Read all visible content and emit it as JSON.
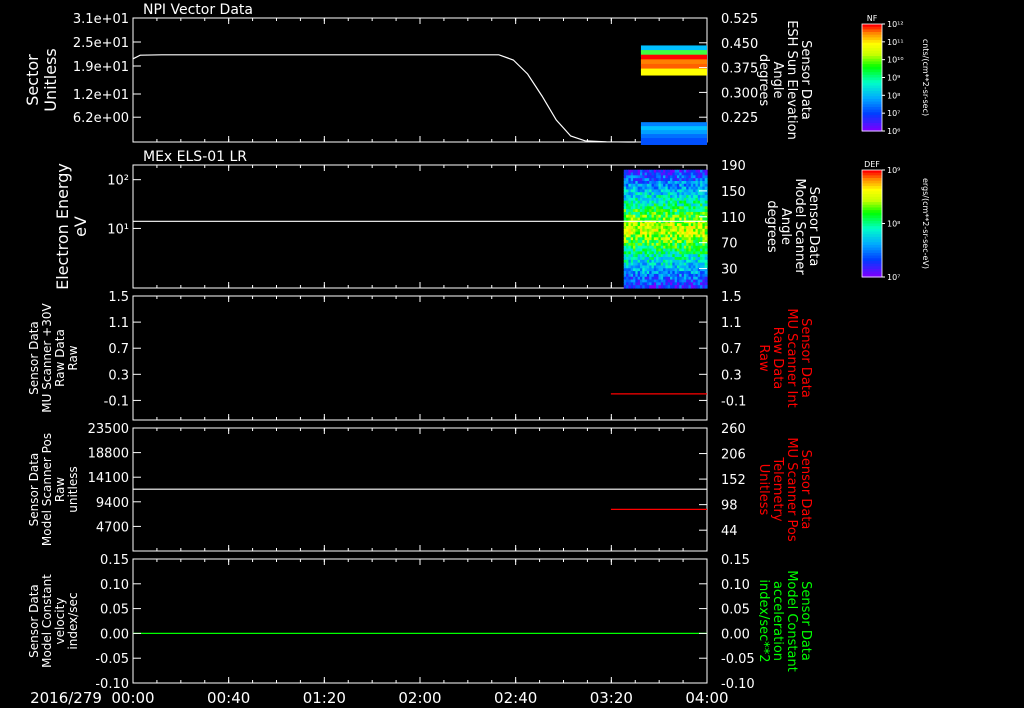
{
  "colors": {
    "background": "#000000",
    "foreground": "#ffffff",
    "red": "#ff0000",
    "green": "#00ff00"
  },
  "x_ticks": [
    "00:00",
    "00:40",
    "01:20",
    "02:00",
    "02:40",
    "03:20",
    "04:00"
  ],
  "date_label": "2016/279",
  "chart_data": [
    {
      "type": "line",
      "title": "NPI Vector Data",
      "ylabel": [
        "Sector",
        "Unitless"
      ],
      "yticks": [
        "3.1e+01",
        "2.5e+01",
        "1.9e+01",
        "1.2e+01",
        "6.2e+00"
      ],
      "ylim": [
        0,
        31
      ],
      "y2label": [
        "Sensor Data",
        "ESH Sun Elevation",
        "Angle",
        "degrees"
      ],
      "y2ticks": [
        "0.525",
        "0.450",
        "0.375",
        "0.300",
        "0.225"
      ],
      "y2lim": [
        0.15,
        0.525
      ],
      "series": [
        {
          "color": "#ffffff",
          "x": [
            0,
            0.05,
            0.2,
            1.0,
            1.8,
            2.55,
            2.65,
            2.75,
            2.85,
            2.95,
            3.05,
            3.15,
            3.3,
            3.45,
            3.5
          ],
          "y": [
            20.8,
            21.7,
            21.8,
            21.8,
            21.8,
            21.8,
            20.5,
            17.0,
            11.5,
            5.5,
            1.5,
            0.3,
            0.05,
            0.0,
            0.0
          ]
        }
      ],
      "heatmap_blocks": [
        {
          "x": [
            3.47,
            4.0
          ],
          "y2_bands": [
            0.442,
            0.428,
            0.414,
            0.4,
            0.386,
            0.372
          ],
          "colors": [
            "#00c0ff",
            "#40ff40",
            "#ff0000",
            "#ff8000",
            "#ff6000",
            "#ffff00"
          ]
        },
        {
          "x": [
            3.47,
            4.0
          ],
          "y2_bands": [
            0.21,
            0.198,
            0.186,
            0.174,
            0.162
          ],
          "colors": [
            "#0080ff",
            "#00c0ff",
            "#00a0ff",
            "#0070ff",
            "#0050ff"
          ]
        }
      ],
      "colorbar": {
        "label": "NF",
        "ticks": [
          "10¹²",
          "10¹¹",
          "10¹⁰",
          "10⁹",
          "10⁸",
          "10⁷",
          "10⁶"
        ],
        "unit": "cnts/(cm**2-sr-sec)"
      }
    },
    {
      "type": "line",
      "title": "MEx ELS-01 LR",
      "ylabel": [
        "Electron Energy",
        "eV"
      ],
      "yticks": [
        "10²",
        "10¹"
      ],
      "yscale": "log",
      "ylim": [
        0.6,
        200
      ],
      "y2label": [
        "Sensor Data",
        "Model Scanner",
        "Angle",
        "degrees"
      ],
      "y2ticks": [
        "190",
        "150",
        "110",
        "70",
        "30"
      ],
      "y2lim": [
        0,
        190
      ],
      "series": [
        {
          "color": "#ffffff",
          "x": [
            0,
            4.0
          ],
          "y": [
            14,
            14
          ]
        }
      ],
      "heatmap_blocks": [
        {
          "x": [
            3.42,
            4.0
          ],
          "y_range": [
            0.6,
            160
          ]
        }
      ],
      "colorbar": {
        "label": "DEF",
        "ticks": [
          "10⁹",
          "10⁸",
          "10⁷"
        ],
        "unit": "ergs/(cm**2-sr-sec-eV)"
      }
    },
    {
      "type": "line",
      "ylabel": [
        "Sensor Data",
        "MU Scanner +30V",
        "Raw Data",
        "Raw"
      ],
      "yticks": [
        "1.5",
        "1.1",
        "0.7",
        "0.3",
        "-0.1"
      ],
      "ylim": [
        -0.4,
        1.5
      ],
      "y2label": [
        "Sensor Data",
        "MU Scanner Int",
        "Raw Data",
        "Raw"
      ],
      "y2ticks": [
        "1.5",
        "1.1",
        "0.7",
        "0.3",
        "-0.1"
      ],
      "y2lim": [
        -0.4,
        1.5
      ],
      "series": [
        {
          "color": "#ff0000",
          "axis": "y2",
          "x": [
            3.33,
            4.0
          ],
          "y": [
            0.0,
            0.0
          ]
        }
      ]
    },
    {
      "type": "line",
      "ylabel": [
        "Sensor Data",
        "Model Scanner Pos",
        "Raw",
        "unitless"
      ],
      "yticks": [
        "23500",
        "18800",
        "14100",
        "9400",
        "4700"
      ],
      "ylim": [
        0,
        23500
      ],
      "y2label": [
        "Sensor Data",
        "MU Scanner Pos",
        "Telemetry",
        "Unitless"
      ],
      "y2ticks": [
        "260",
        "206",
        "152",
        "98",
        "44"
      ],
      "y2lim": [
        0,
        260
      ],
      "series": [
        {
          "color": "#ffffff",
          "x": [
            0,
            4.0
          ],
          "y": [
            11800,
            11800
          ]
        },
        {
          "color": "#ff0000",
          "axis": "y2",
          "x": [
            3.33,
            4.0
          ],
          "y": [
            88,
            88
          ]
        }
      ]
    },
    {
      "type": "line",
      "ylabel": [
        "Sensor Data",
        "Model Constant",
        "velocity",
        "index/sec"
      ],
      "yticks": [
        "0.15",
        "0.10",
        "0.05",
        "0.00",
        "-0.05",
        "-0.10"
      ],
      "ylim": [
        -0.1,
        0.15
      ],
      "y2label": [
        "Sensor Data",
        "Model Constant",
        "acceleration",
        "index/sec**2"
      ],
      "y2ticks": [
        "0.15",
        "0.10",
        "0.05",
        "0.00",
        "-0.05",
        "-0.10"
      ],
      "y2lim": [
        -0.1,
        0.15
      ],
      "series": [
        {
          "color": "#00ff00",
          "x": [
            0,
            4.0
          ],
          "y": [
            0.0,
            0.0
          ]
        }
      ]
    }
  ]
}
